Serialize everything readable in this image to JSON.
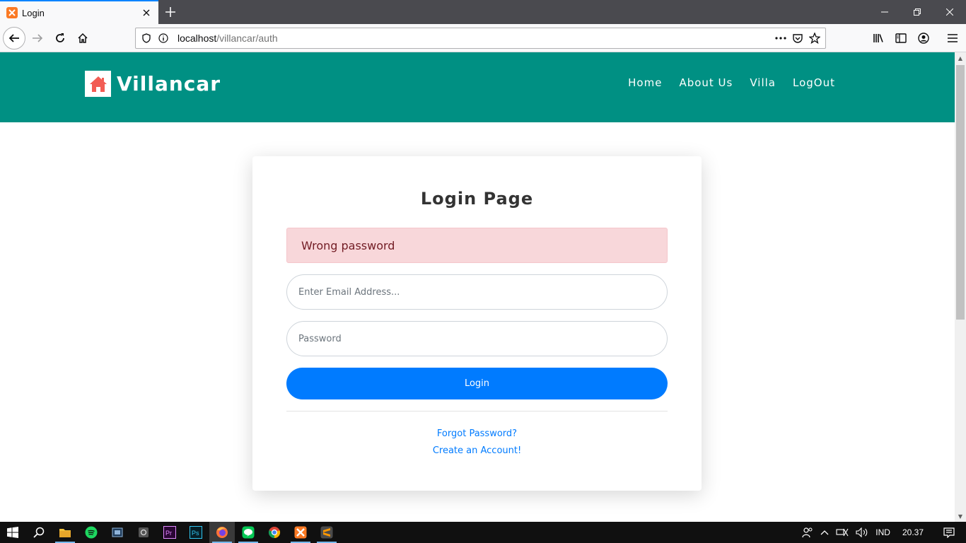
{
  "browser": {
    "tab_title": "Login",
    "url_host": "localhost",
    "url_path": "/villancar/auth"
  },
  "site": {
    "brand": "Villancar",
    "menu": [
      "Home",
      "About Us",
      "Villa",
      "LogOut"
    ],
    "brand_color": "#009083"
  },
  "login": {
    "title": "Login Page",
    "alert": "Wrong password",
    "email_placeholder": "Enter Email Address...",
    "password_placeholder": "Password",
    "submit_label": "Login",
    "forgot_label": "Forgot Password?",
    "create_label": "Create an Account!",
    "alert_bg": "#f8d7da",
    "button_color": "#007bff"
  },
  "taskbar": {
    "apps": [
      "windows-start",
      "search",
      "file-explorer",
      "spotify",
      "media-app",
      "camera-app",
      "premiere-pro",
      "photoshop",
      "firefox",
      "line",
      "chrome",
      "xampp",
      "sublime-text"
    ],
    "language": "IND",
    "time": "20.37"
  }
}
